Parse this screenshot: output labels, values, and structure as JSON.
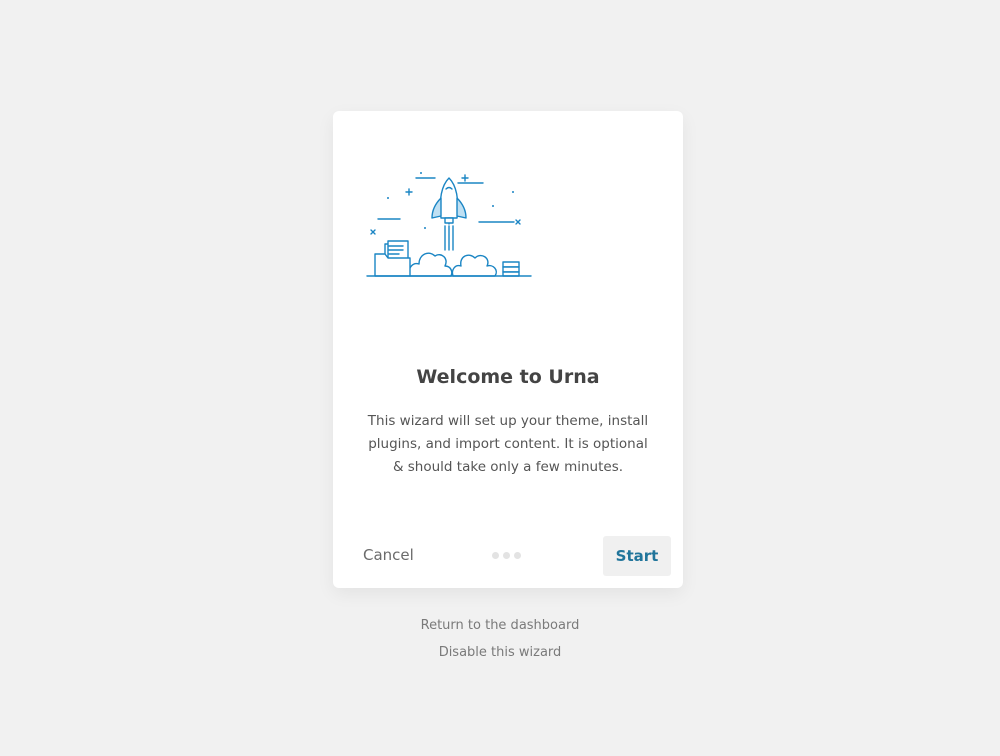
{
  "wizard": {
    "title": "Welcome to Urna",
    "description": "This wizard will set up your theme, install plugins, and import content. It is optional & should take only a few minutes.",
    "cancel_label": "Cancel",
    "start_label": "Start",
    "steps_total": 3,
    "current_step": 1
  },
  "footer": {
    "return_link": "Return to the dashboard",
    "disable_link": "Disable this wizard"
  },
  "colors": {
    "background": "#f1f1f1",
    "card": "#ffffff",
    "accent": "#21759b",
    "illustration_stroke": "#1a85c4",
    "illustration_fill": "#bfe0f3"
  },
  "icons": {
    "illustration": "rocket-launch-illustration"
  }
}
